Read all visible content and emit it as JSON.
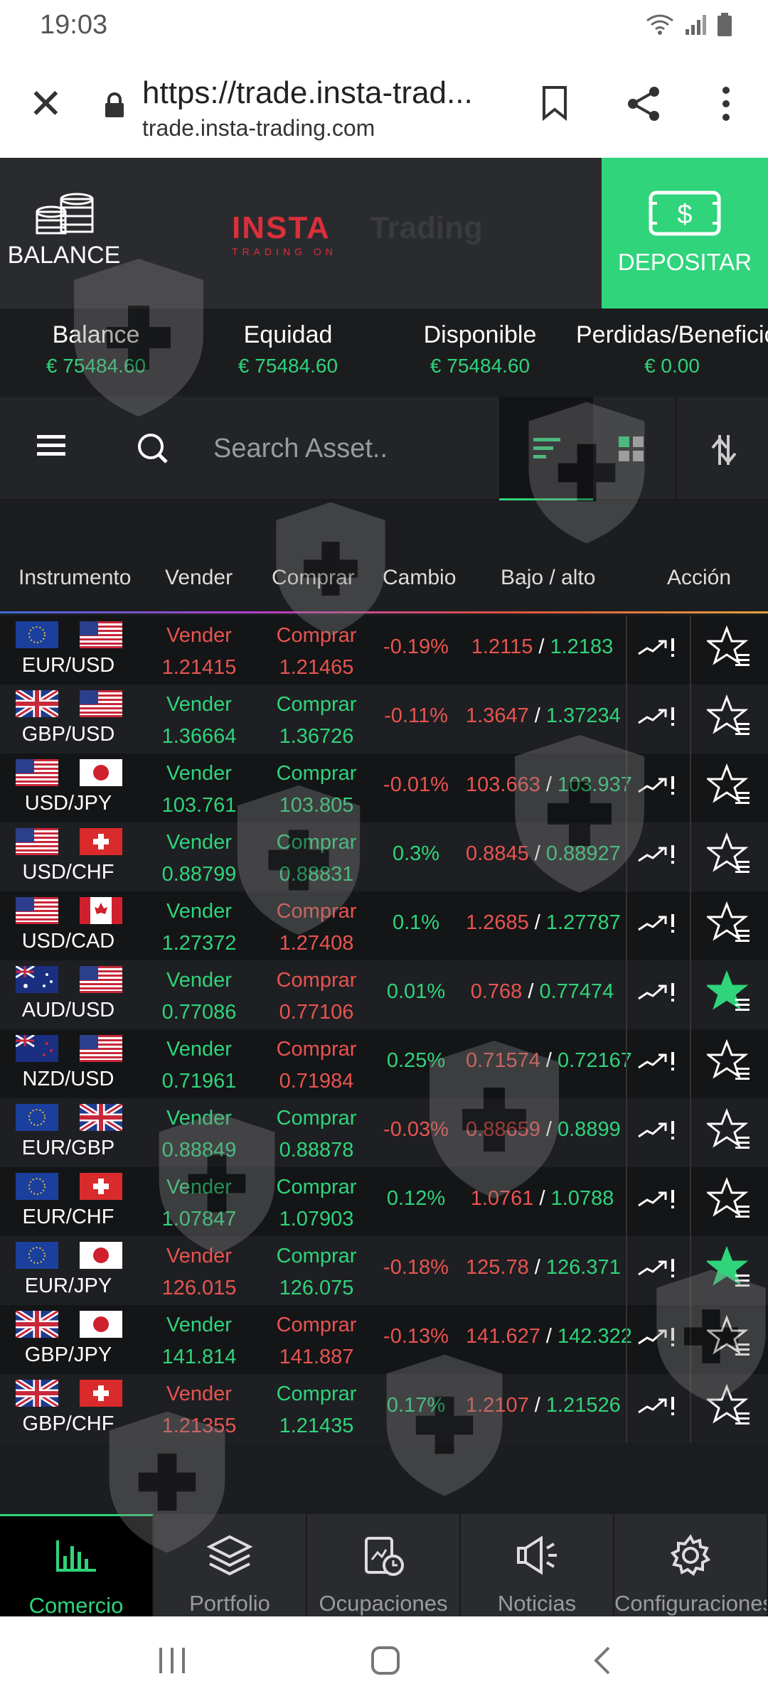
{
  "status": {
    "time": "19:03"
  },
  "browser": {
    "url": "https://trade.insta-trad...",
    "host": "trade.insta-trading.com"
  },
  "header": {
    "balance_label": "BALANCE",
    "logo_main": "INSTA",
    "logo_sub": "TRADING ON",
    "logo_trail": "Trading",
    "deposit_label": "DEPOSITAR"
  },
  "stats": [
    {
      "label": "Balance",
      "value": "€ 75484.60"
    },
    {
      "label": "Equidad",
      "value": "€ 75484.60"
    },
    {
      "label": "Disponible",
      "value": "€ 75484.60"
    },
    {
      "label": "Perdidas/Beneficios",
      "value": "€ 0.00"
    }
  ],
  "search": {
    "placeholder": "Search Asset.."
  },
  "table": {
    "headers": {
      "instrument": "Instrumento",
      "sell": "Vender",
      "buy": "Comprar",
      "change": "Cambio",
      "lowhigh": "Bajo / alto",
      "action": "Acción"
    },
    "sell_label": "Vender",
    "buy_label": "Comprar",
    "rows": [
      {
        "pair": "EUR/USD",
        "f1": "eu",
        "f2": "us",
        "sell": "1.21415",
        "sell_c": "red",
        "buy": "1.21465",
        "buy_c": "red",
        "chg": "-0.19%",
        "chg_c": "red",
        "low": "1.2115",
        "low_c": "red",
        "high": "1.2183",
        "high_c": "green",
        "fav": false
      },
      {
        "pair": "GBP/USD",
        "f1": "gb",
        "f2": "us",
        "sell": "1.36664",
        "sell_c": "green",
        "buy": "1.36726",
        "buy_c": "green",
        "chg": "-0.11%",
        "chg_c": "red",
        "low": "1.3647",
        "low_c": "red",
        "high": "1.37234",
        "high_c": "green",
        "fav": false
      },
      {
        "pair": "USD/JPY",
        "f1": "us",
        "f2": "jp",
        "sell": "103.761",
        "sell_c": "green",
        "buy": "103.805",
        "buy_c": "green",
        "chg": "-0.01%",
        "chg_c": "red",
        "low": "103.663",
        "low_c": "red",
        "high": "103.937",
        "high_c": "green",
        "fav": false
      },
      {
        "pair": "USD/CHF",
        "f1": "us",
        "f2": "ch",
        "sell": "0.88799",
        "sell_c": "green",
        "buy": "0.88831",
        "buy_c": "green",
        "chg": "0.3%",
        "chg_c": "green",
        "low": "0.8845",
        "low_c": "red",
        "high": "0.88927",
        "high_c": "green",
        "fav": false
      },
      {
        "pair": "USD/CAD",
        "f1": "us",
        "f2": "ca",
        "sell": "1.27372",
        "sell_c": "green",
        "buy": "1.27408",
        "buy_c": "red",
        "chg": "0.1%",
        "chg_c": "green",
        "low": "1.2685",
        "low_c": "red",
        "high": "1.27787",
        "high_c": "green",
        "fav": false
      },
      {
        "pair": "AUD/USD",
        "f1": "au",
        "f2": "us",
        "sell": "0.77086",
        "sell_c": "green",
        "buy": "0.77106",
        "buy_c": "red",
        "chg": "0.01%",
        "chg_c": "green",
        "low": "0.768",
        "low_c": "red",
        "high": "0.77474",
        "high_c": "green",
        "fav": true
      },
      {
        "pair": "NZD/USD",
        "f1": "nz",
        "f2": "us",
        "sell": "0.71961",
        "sell_c": "green",
        "buy": "0.71984",
        "buy_c": "red",
        "chg": "0.25%",
        "chg_c": "green",
        "low": "0.71574",
        "low_c": "red",
        "high": "0.72167",
        "high_c": "green",
        "fav": false
      },
      {
        "pair": "EUR/GBP",
        "f1": "eu",
        "f2": "gb",
        "sell": "0.88849",
        "sell_c": "green",
        "buy": "0.88878",
        "buy_c": "green",
        "chg": "-0.03%",
        "chg_c": "red",
        "low": "0.88659",
        "low_c": "red",
        "high": "0.8899",
        "high_c": "green",
        "fav": false
      },
      {
        "pair": "EUR/CHF",
        "f1": "eu",
        "f2": "ch",
        "sell": "1.07847",
        "sell_c": "green",
        "buy": "1.07903",
        "buy_c": "green",
        "chg": "0.12%",
        "chg_c": "green",
        "low": "1.0761",
        "low_c": "red",
        "high": "1.0788",
        "high_c": "green",
        "fav": false
      },
      {
        "pair": "EUR/JPY",
        "f1": "eu",
        "f2": "jp",
        "sell": "126.015",
        "sell_c": "red",
        "buy": "126.075",
        "buy_c": "green",
        "chg": "-0.18%",
        "chg_c": "red",
        "low": "125.78",
        "low_c": "red",
        "high": "126.371",
        "high_c": "green",
        "fav": true
      },
      {
        "pair": "GBP/JPY",
        "f1": "gb",
        "f2": "jp",
        "sell": "141.814",
        "sell_c": "green",
        "buy": "141.887",
        "buy_c": "red",
        "chg": "-0.13%",
        "chg_c": "red",
        "low": "141.627",
        "low_c": "red",
        "high": "142.322",
        "high_c": "green",
        "fav": false
      },
      {
        "pair": "GBP/CHF",
        "f1": "gb",
        "f2": "ch",
        "sell": "1.21355",
        "sell_c": "red",
        "buy": "1.21435",
        "buy_c": "green",
        "chg": "0.17%",
        "chg_c": "green",
        "low": "1.2107",
        "low_c": "red",
        "high": "1.21526",
        "high_c": "green",
        "fav": false
      }
    ]
  },
  "nav": [
    {
      "label": "Comercio",
      "icon": "chart-bars-icon",
      "active": true
    },
    {
      "label": "Portfolio",
      "icon": "layers-icon",
      "active": false
    },
    {
      "label": "Ocupaciones",
      "icon": "clipboard-clock-icon",
      "active": false
    },
    {
      "label": "Noticias",
      "icon": "megaphone-icon",
      "active": false
    },
    {
      "label": "Configuraciones",
      "icon": "gear-icon",
      "active": false
    }
  ],
  "colors": {
    "accent": "#2fd47b",
    "negative": "#e8544f",
    "background": "#1c1d1f"
  }
}
